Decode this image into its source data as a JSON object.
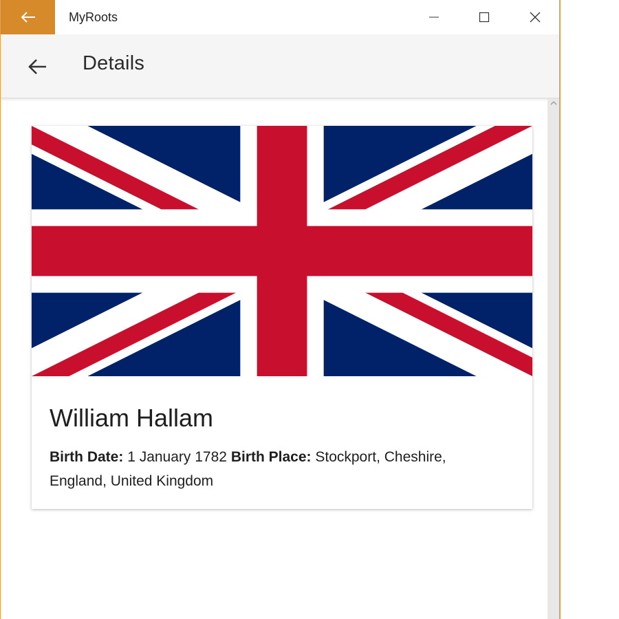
{
  "window": {
    "app_title": "MyRoots",
    "accent_color": "#d68a2a"
  },
  "appbar": {
    "page_title": "Details"
  },
  "person": {
    "name": "William Hallam",
    "birth_date_label": "Birth Date:",
    "birth_date": "1 January 1782",
    "birth_place_label": "Birth Place:",
    "birth_place": "Stockport, Cheshire, England, United Kingdom",
    "flag": "united-kingdom-flag"
  },
  "colors": {
    "flag_blue": "#012169",
    "flag_red": "#C8102E",
    "flag_white": "#FFFFFF"
  }
}
